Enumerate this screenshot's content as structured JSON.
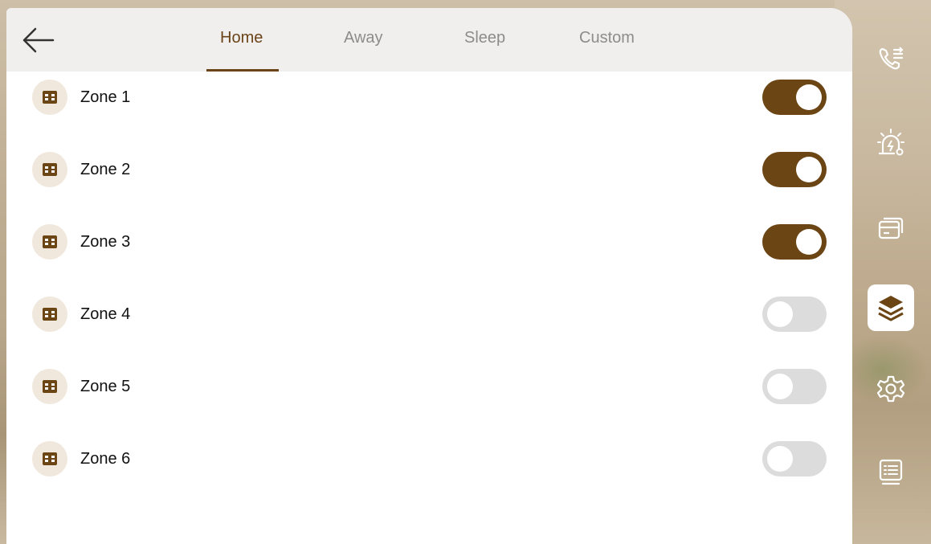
{
  "tabs": [
    {
      "label": "Home",
      "active": true
    },
    {
      "label": "Away",
      "active": false
    },
    {
      "label": "Sleep",
      "active": false
    },
    {
      "label": "Custom",
      "active": false
    }
  ],
  "zones": [
    {
      "label": "Zone 1",
      "enabled": true
    },
    {
      "label": "Zone 2",
      "enabled": true
    },
    {
      "label": "Zone 3",
      "enabled": true
    },
    {
      "label": "Zone 4",
      "enabled": false
    },
    {
      "label": "Zone 5",
      "enabled": false
    },
    {
      "label": "Zone 6",
      "enabled": false
    }
  ],
  "sidebar": {
    "items": [
      {
        "icon": "call-settings-icon",
        "active": false
      },
      {
        "icon": "alarm-settings-icon",
        "active": false
      },
      {
        "icon": "card-icon",
        "active": false
      },
      {
        "icon": "layers-icon",
        "active": true
      },
      {
        "icon": "gear-icon",
        "active": false
      },
      {
        "icon": "message-list-icon",
        "active": false
      }
    ]
  },
  "colors": {
    "accent": "#6b4514",
    "toggle_off": "#dcdcdc",
    "topbar": "#f1efed"
  }
}
